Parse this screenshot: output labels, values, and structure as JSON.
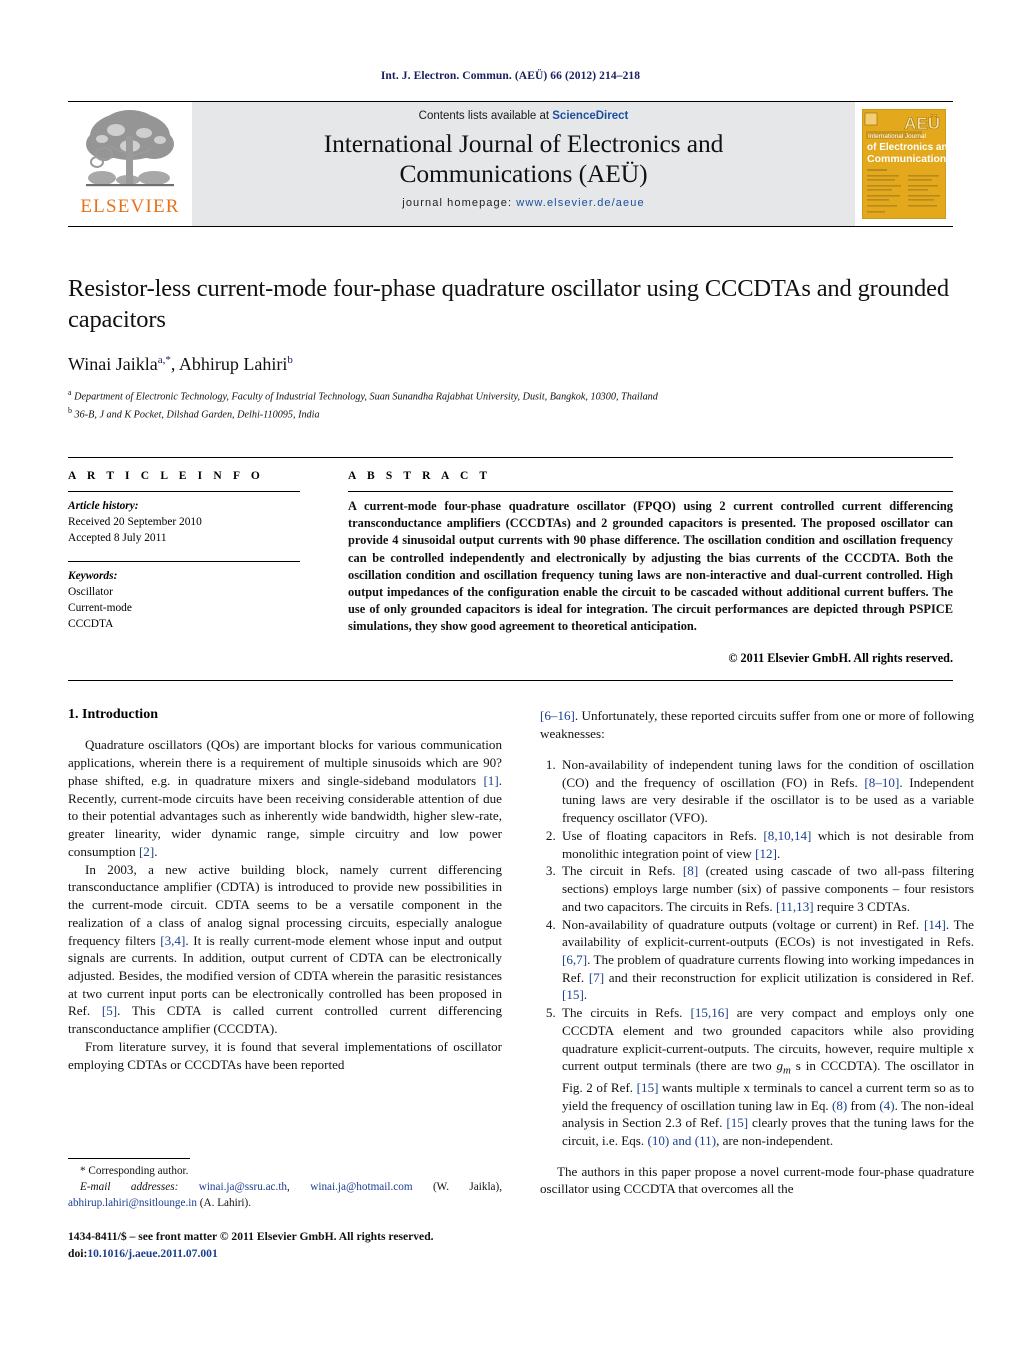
{
  "running_head": "Int. J. Electron. Commun. (AEÜ) 66 (2012) 214–218",
  "masthead": {
    "publisher_name": "ELSEVIER",
    "contents_prefix": "Contents lists available at ",
    "contents_link": "ScienceDirect",
    "journal_title_line1": "International Journal of Electronics and",
    "journal_title_line2": "Communications (AEÜ)",
    "homepage_label": "journal homepage: ",
    "homepage_url": "www.elsevier.de/aeue",
    "cover": {
      "brand": "AEÜ",
      "line1": "International Journal",
      "line2": "of Electronics and",
      "line3": "Communications"
    }
  },
  "article": {
    "title": "Resistor-less current-mode four-phase quadrature oscillator using CCCDTAs and grounded capacitors",
    "author1_name": "Winai Jaikla",
    "author1_marks": "a,*",
    "author2_name": "Abhirup Lahiri",
    "author2_marks": "b",
    "affiliation_a_mark": "a",
    "affiliation_a": "Department of Electronic Technology, Faculty of Industrial Technology, Suan Sunandha Rajabhat University, Dusit, Bangkok, 10300, Thailand",
    "affiliation_b_mark": "b",
    "affiliation_b": "36-B, J and K Pocket, Dilshad Garden, Delhi-110095, India"
  },
  "info": {
    "heading": "A R T I C L E   I N F O",
    "history_label": "Article history:",
    "history_received": "Received 20 September 2010",
    "history_accepted": "Accepted 8 July 2011",
    "keywords_label": "Keywords:",
    "keywords": [
      "Oscillator",
      "Current-mode",
      "CCCDTA"
    ]
  },
  "abstract": {
    "heading": "A B S T R A C T",
    "text": "A current-mode four-phase quadrature oscillator (FPQO) using 2 current controlled current differencing transconductance amplifiers (CCCDTAs) and 2 grounded capacitors is presented. The proposed oscillator can provide 4 sinusoidal output currents with 90 phase difference. The oscillation condition and oscillation frequency can be controlled independently and electronically by adjusting the bias currents of the CCCDTA. Both the oscillation condition and oscillation frequency tuning laws are non-interactive and dual-current controlled. High output impedances of the configuration enable the circuit to be cascaded without additional current buffers. The use of only grounded capacitors is ideal for integration. The circuit performances are depicted through PSPICE simulations, they show good agreement to theoretical anticipation.",
    "copyright": "© 2011 Elsevier GmbH. All rights reserved."
  },
  "body": {
    "section1_heading": "1.  Introduction",
    "p1": "Quadrature oscillators (QOs) are important blocks for various communication applications, wherein there is a requirement of multiple sinusoids which are 90? phase shifted, e.g. in quadrature mixers and single-sideband modulators [1]. Recently, current-mode circuits have been receiving considerable attention of due to their potential advantages such as inherently wide bandwidth, higher slew-rate, greater linearity, wider dynamic range, simple circuitry and low power consumption [2].",
    "p2": "In 2003, a new active building block, namely current differencing transconductance amplifier (CDTA) is introduced to provide new possibilities in the current-mode circuit. CDTA seems to be a versatile component in the realization of a class of analog signal processing circuits, especially analogue frequency filters [3,4]. It is really current-mode element whose input and output signals are currents. In addition, output current of CDTA can be electronically adjusted. Besides, the modified version of CDTA wherein the parasitic resistances at two current input ports can be electronically controlled has been proposed in Ref. [5]. This CDTA is called current controlled current differencing transconductance amplifier (CCCDTA).",
    "p3": "From literature survey, it is found that several implementations of oscillator employing CDTAs or CCCDTAs have been reported",
    "p4_continuation": "[6–16]. Unfortunately, these reported circuits suffer from one or more of following weaknesses:",
    "weaknesses": [
      "Non-availability of independent tuning laws for the condition of oscillation (CO) and the frequency of oscillation (FO) in Refs. [8–10]. Independent tuning laws are very desirable if the oscillator is to be used as a variable frequency oscillator (VFO).",
      "Use of floating capacitors in Refs. [8,10,14] which is not desirable from monolithic integration point of view [12].",
      "The circuit in Refs. [8] (created using cascade of two all-pass filtering sections) employs large number (six) of passive components – four resistors and two capacitors. The circuits in Refs. [11,13] require 3 CDTAs.",
      "Non-availability of quadrature outputs (voltage or current) in Ref. [14]. The availability of explicit-current-outputs (ECOs) is not investigated in Refs. [6,7]. The problem of quadrature currents flowing into working impedances in Ref. [7] and their reconstruction for explicit utilization is considered in Ref. [15].",
      "The circuits in Refs. [15,16] are very compact and employs only one CCCDTA element and two grounded capacitors while also providing quadrature explicit-current-outputs. The circuits, however, require multiple x current output terminals (there are two gm s in CCCDTA). The oscillator in Fig. 2 of Ref. [15] wants multiple x terminals to cancel a current term so as to yield the frequency of oscillation tuning law in Eq. (8) from (4). The non-ideal analysis in Section 2.3 of Ref. [15] clearly proves that the tuning laws for the circuit, i.e. Eqs. (10) and (11), are non-independent."
    ],
    "p5": "The authors in this paper propose a novel current-mode four-phase quadrature oscillator using CCCDTA that overcomes all the"
  },
  "footnote": {
    "corresponding_mark": "*",
    "corresponding_label": "Corresponding author.",
    "email_label": "E-mail addresses:",
    "email1": "winai.ja@ssru.ac.th",
    "email2": "winai.ja@hotmail.com",
    "email1_attrib": "(W. Jaikla),",
    "email3": "abhirup.lahiri@nsitlounge.in",
    "email3_attrib": "(A. Lahiri).",
    "issn_line": "1434-8411/$ – see front matter © 2011 Elsevier GmbH. All rights reserved.",
    "doi_label": "doi:",
    "doi_value": "10.1016/j.aeue.2011.07.001"
  },
  "colors": {
    "link": "#1a3f8f",
    "running_head": "#1a2060",
    "elsevier_orange": "#E8721C",
    "band_gray": "#e6e7e9",
    "cover_gold": "#E3A81C"
  }
}
